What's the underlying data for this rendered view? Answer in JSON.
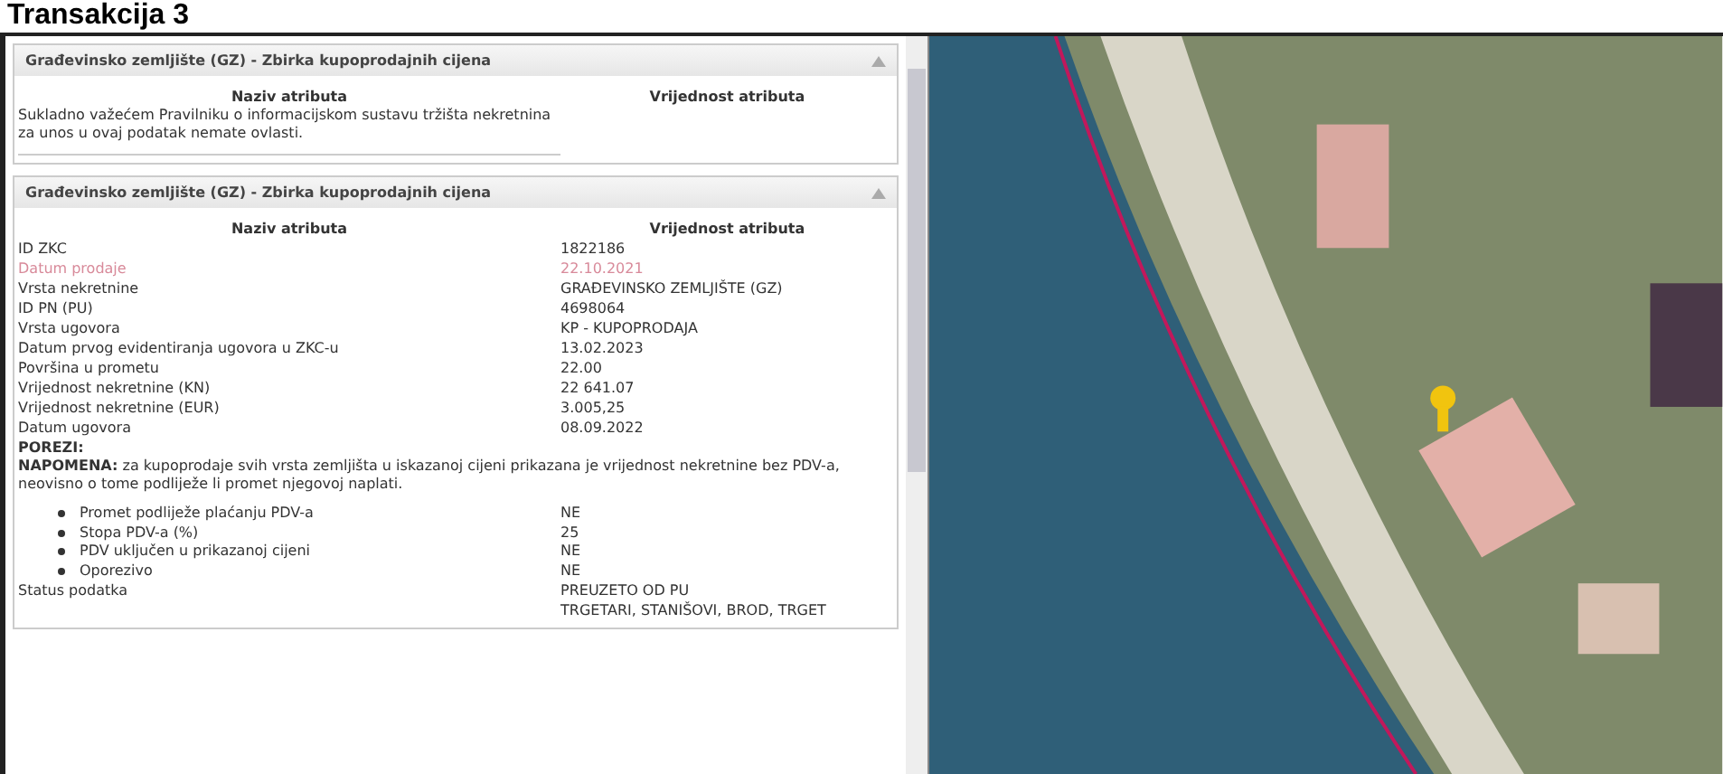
{
  "page_title": "Transakcija 3",
  "panels": [
    {
      "header": "Građevinsko zemljište (GZ) - Zbirka kupoprodajnih cijena",
      "columns": [
        "Naziv atributa",
        "Vrijednost atributa"
      ],
      "note": "Sukladno važećem Pravilniku o informacijskom sustavu tržišta nekretnina za unos u ovaj podatak nemate ovlasti."
    },
    {
      "header": "Građevinsko zemljište (GZ) - Zbirka kupoprodajnih cijena",
      "columns": [
        "Naziv atributa",
        "Vrijednost atributa"
      ],
      "rows": [
        {
          "kind": "attr",
          "label": "ID ZKC",
          "value": "1822186",
          "highlighted": false
        },
        {
          "kind": "attr",
          "label": "Datum prodaje",
          "value": "22.10.2021",
          "highlighted": true
        },
        {
          "kind": "attr",
          "label": "Vrsta nekretnine",
          "value": "GRAĐEVINSKO ZEMLJIŠTE (GZ)",
          "highlighted": false
        },
        {
          "kind": "attr",
          "label": "ID PN (PU)",
          "value": "4698064",
          "highlighted": false
        },
        {
          "kind": "attr",
          "label": "Vrsta ugovora",
          "value": "KP - KUPOPRODAJA",
          "highlighted": false
        },
        {
          "kind": "attr",
          "label": "Datum prvog evidentiranja ugovora u ZKC-u",
          "value": "13.02.2023",
          "highlighted": false
        },
        {
          "kind": "attr",
          "label": "Površina u prometu",
          "value": "22.00",
          "highlighted": false
        },
        {
          "kind": "attr",
          "label": "Vrijednost nekretnine (KN)",
          "value": "22 641.07",
          "highlighted": false
        },
        {
          "kind": "attr",
          "label": "Vrijednost nekretnine (EUR)",
          "value": "3.005,25",
          "highlighted": false
        },
        {
          "kind": "attr",
          "label": "Datum ugovora",
          "value": "08.09.2022",
          "highlighted": false
        },
        {
          "kind": "heading",
          "label": "POREZI:"
        },
        {
          "kind": "note",
          "label": "**NAPOMENA:** za kupoprodaje svih vrsta zemljišta u iskazanoj cijeni prikazana je vrijednost nekretnine bez PDV-a, neovisno o tome podliježe li promet njegovoj naplati."
        },
        {
          "kind": "bullet",
          "label": "Promet podliježe plaćanju PDV-a",
          "value": "NE"
        },
        {
          "kind": "bullet",
          "label": "Stopa PDV-a (%)",
          "value": "25"
        },
        {
          "kind": "bullet",
          "label": "PDV uključen u prikazanoj cijeni",
          "value": "NE"
        },
        {
          "kind": "bullet",
          "label": "Oporezivo",
          "value": "NE"
        },
        {
          "kind": "attr",
          "label": "Status podatka",
          "value": "PREUZETO OD PU",
          "highlighted": false
        },
        {
          "kind": "attr",
          "value": "TRGETARI, STANIŠOVI, BROD, TRGET",
          "highlighted": false
        }
      ]
    }
  ]
}
